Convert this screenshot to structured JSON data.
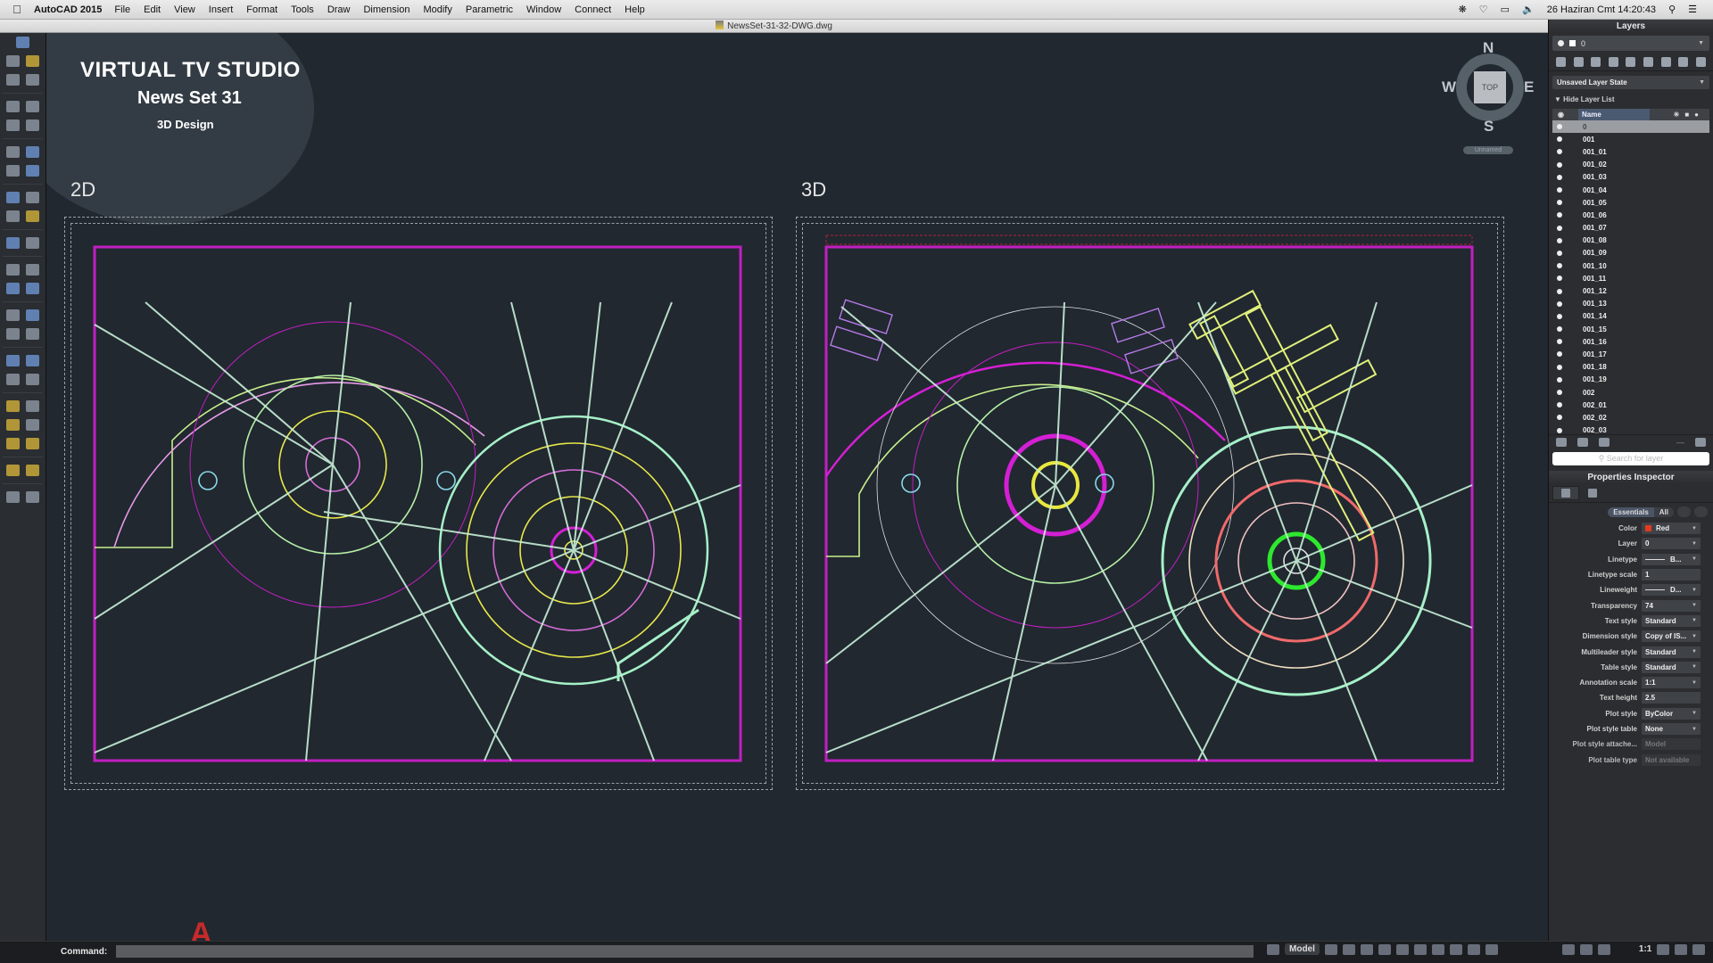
{
  "menubar": {
    "app_name": "AutoCAD 2015",
    "items": [
      "File",
      "Edit",
      "View",
      "Insert",
      "Format",
      "Tools",
      "Draw",
      "Dimension",
      "Modify",
      "Parametric",
      "Window",
      "Connect",
      "Help"
    ],
    "clock": "26 Haziran Cmt  14:20:43"
  },
  "window": {
    "title": "NewsSet-31-32-DWG.dwg"
  },
  "watermark": {
    "title": "VIRTUAL TV STUDIO",
    "subtitle": "News Set 31",
    "caption": "3D Design"
  },
  "viewcube": {
    "face": "TOP",
    "north": "N",
    "south": "S",
    "east": "E",
    "west": "W",
    "ucs": "Unnamed"
  },
  "viewports": {
    "left_label": "2D",
    "right_label": "3D"
  },
  "layers_panel": {
    "title": "Layers",
    "current_layer": "0",
    "layer_state": "Unsaved Layer State",
    "hide_list_label": "Hide Layer List",
    "column_name": "Name",
    "layers": [
      "0",
      "001",
      "001_01",
      "001_02",
      "001_03",
      "001_04",
      "001_05",
      "001_06",
      "001_07",
      "001_08",
      "001_09",
      "001_10",
      "001_11",
      "001_12",
      "001_13",
      "001_14",
      "001_15",
      "001_16",
      "001_17",
      "001_18",
      "001_19",
      "002",
      "002_01",
      "002_02",
      "002_03"
    ],
    "search_placeholder": "Search for layer"
  },
  "properties_inspector": {
    "title": "Properties Inspector",
    "tab_essentials": "Essentials",
    "tab_all": "All",
    "color_accent": "#e23a1e",
    "properties": [
      {
        "label": "Color",
        "value": "Red"
      },
      {
        "label": "Layer",
        "value": "0"
      },
      {
        "label": "Linetype",
        "value": "B..."
      },
      {
        "label": "Linetype scale",
        "value": "1"
      },
      {
        "label": "Lineweight",
        "value": "D..."
      },
      {
        "label": "Transparency",
        "value": "74"
      },
      {
        "label": "Text style",
        "value": "Standard"
      },
      {
        "label": "Dimension style",
        "value": "Copy of IS..."
      },
      {
        "label": "Multileader style",
        "value": "Standard"
      },
      {
        "label": "Table style",
        "value": "Standard"
      },
      {
        "label": "Annotation scale",
        "value": "1:1"
      },
      {
        "label": "Text height",
        "value": "2.5"
      },
      {
        "label": "Plot style",
        "value": "ByColor"
      },
      {
        "label": "Plot style table",
        "value": "None"
      },
      {
        "label": "Plot style attache...",
        "value": "Model"
      },
      {
        "label": "Plot table type",
        "value": "Not available"
      }
    ]
  },
  "command_line": {
    "label": "Command:",
    "value": ""
  },
  "status_bar": {
    "space": "Model",
    "annotation_scale": "1:1"
  }
}
